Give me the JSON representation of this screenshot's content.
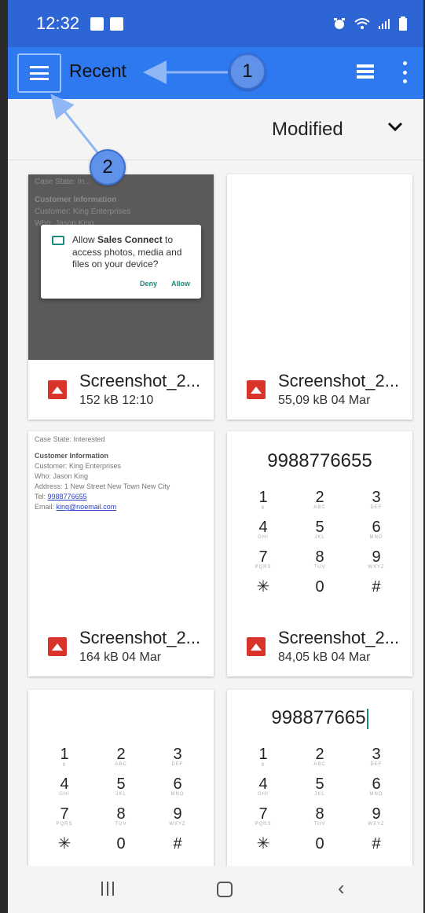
{
  "status_bar": {
    "time": "12:32"
  },
  "app_bar": {
    "title": "Recent"
  },
  "callouts": {
    "one": "1",
    "two": "2"
  },
  "sort": {
    "label": "Modified"
  },
  "files": [
    {
      "name": "Screenshot_2...",
      "meta": "152 kB 12:10"
    },
    {
      "name": "Screenshot_2...",
      "meta": "55,09 kB 04 Mar"
    },
    {
      "name": "Screenshot_2...",
      "meta": "164 kB 04 Mar"
    },
    {
      "name": "Screenshot_2...",
      "meta": "84,05 kB 04 Mar"
    }
  ],
  "thumb1": {
    "ghost_lines": [
      "Case State: In...",
      "Customer Information",
      "Customer: King Enterprises",
      "Who: Jason King"
    ],
    "dialog_text_pre": "Allow ",
    "dialog_app": "Sales Connect",
    "dialog_text_post": " to access photos, media and files on your device?",
    "deny": "Deny",
    "allow": "Allow"
  },
  "thumb3": {
    "case_state": "Case State: Interested",
    "heading": "Customer Information",
    "customer": "Customer: King Enterprises",
    "who": "Who: Jason King",
    "address": "Address: 1 New Street New Town New City",
    "tel_label": "Tel:",
    "tel": "9988776655",
    "email_label": "Email:",
    "email": "king@noemail.com"
  },
  "thumb4": {
    "number": "9988776655"
  },
  "thumb6": {
    "number": "998877665"
  },
  "keypad": [
    {
      "d": "1",
      "l": "Ⅱ"
    },
    {
      "d": "2",
      "l": "ABC"
    },
    {
      "d": "3",
      "l": "DEF"
    },
    {
      "d": "4",
      "l": "GHI"
    },
    {
      "d": "5",
      "l": "JKL"
    },
    {
      "d": "6",
      "l": "MNO"
    },
    {
      "d": "7",
      "l": "PQRS"
    },
    {
      "d": "8",
      "l": "TUV"
    },
    {
      "d": "9",
      "l": "WXYZ"
    },
    {
      "d": "✳",
      "l": ""
    },
    {
      "d": "0",
      "l": ""
    },
    {
      "d": "#",
      "l": ""
    }
  ]
}
